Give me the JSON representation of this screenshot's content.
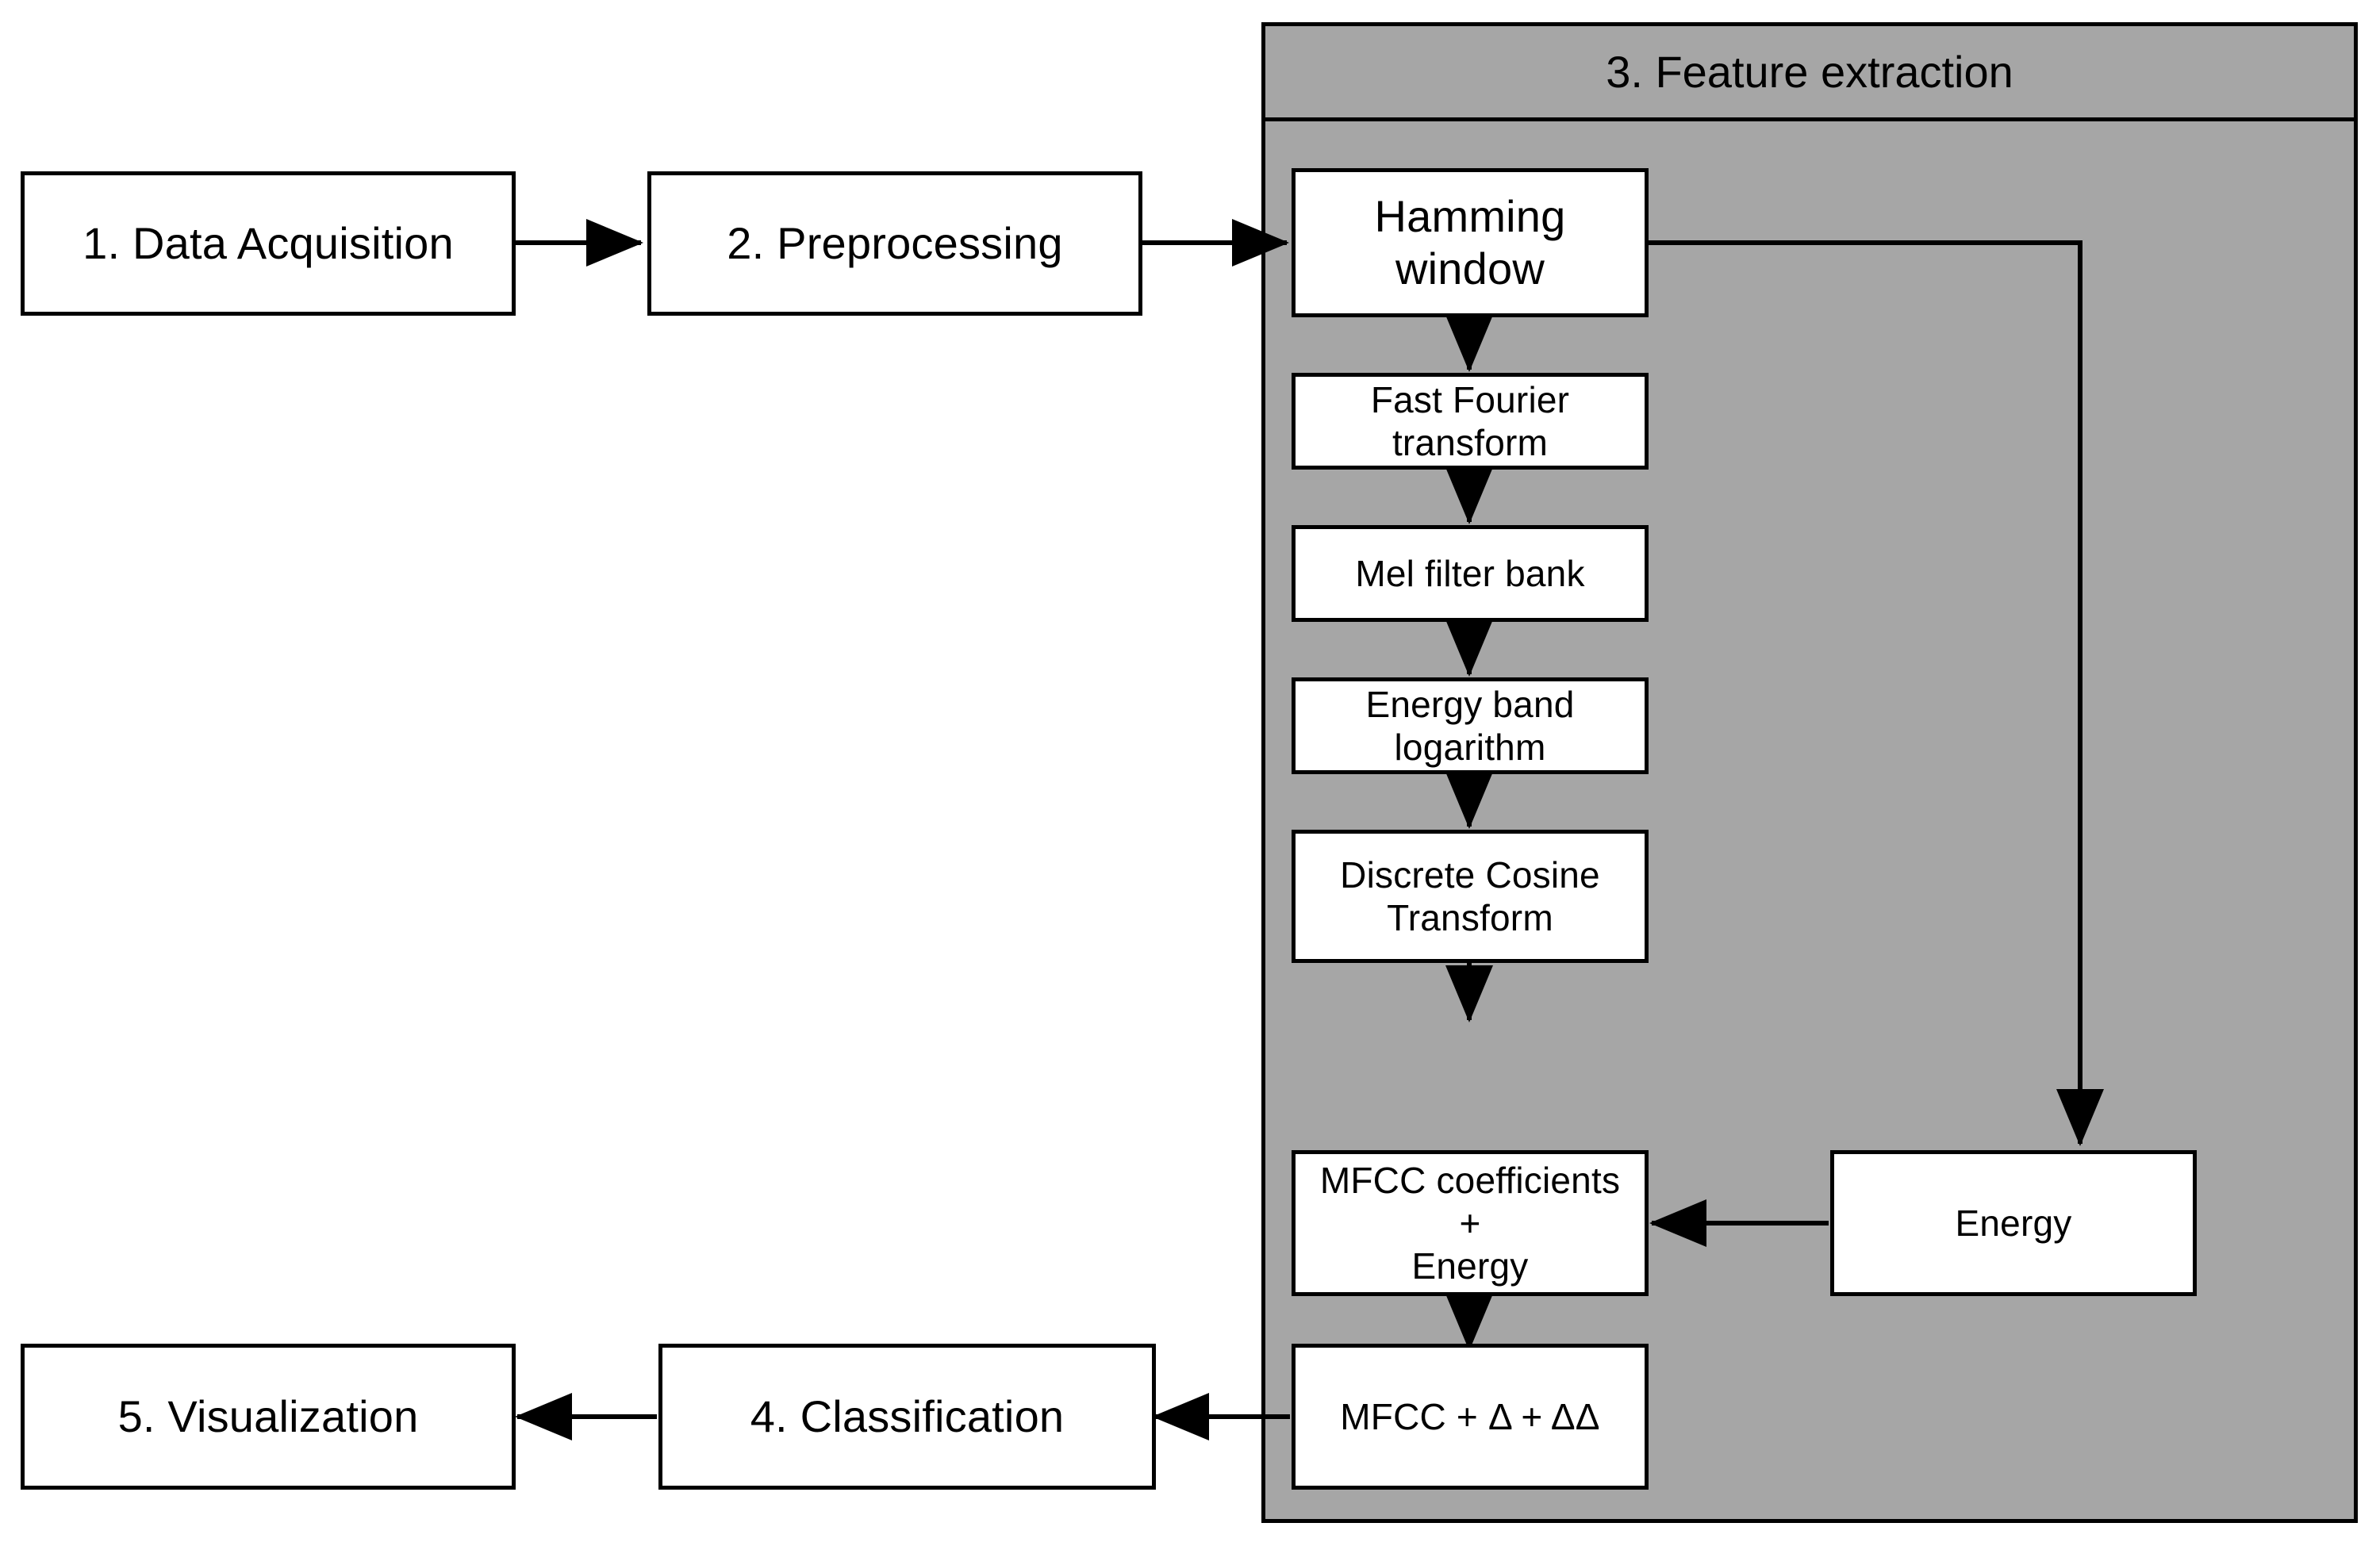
{
  "diagram": {
    "title": "Speech processing pipeline flowchart",
    "background_color": "#ffffff",
    "panel_fill_color": "#a6a6a6",
    "box_fill_color": "#ffffff",
    "line_color": "#000000"
  },
  "stages": {
    "data_acquisition": "1. Data Acquisition",
    "preprocessing": "2. Preprocessing",
    "feature_extraction": "3. Feature extraction",
    "classification": "4. Classification",
    "visualization": "5. Visualization"
  },
  "feature_extraction_steps": {
    "hamming_window": "Hamming window",
    "fast_fourier_transform": "Fast Fourier transform",
    "mel_filter_bank": "Mel filter bank",
    "energy_band_logarithm": "Energy band logarithm",
    "discrete_cosine_transform": "Discrete Cosine\nTransform",
    "mfcc_coefficients_energy": "MFCC coefficients +\nEnergy",
    "energy": "Energy",
    "mfcc_deltas": "MFCC + Δ + ΔΔ"
  },
  "flow": {
    "edges": [
      {
        "from": "1. Data Acquisition",
        "to": "2. Preprocessing"
      },
      {
        "from": "2. Preprocessing",
        "to": "Hamming window"
      },
      {
        "from": "Hamming window",
        "to": "Fast Fourier transform"
      },
      {
        "from": "Hamming window",
        "to": "Energy"
      },
      {
        "from": "Fast Fourier transform",
        "to": "Mel filter bank"
      },
      {
        "from": "Mel filter bank",
        "to": "Energy band logarithm"
      },
      {
        "from": "Energy band logarithm",
        "to": "Discrete Cosine Transform"
      },
      {
        "from": "Discrete Cosine Transform",
        "to": "MFCC coefficients + Energy"
      },
      {
        "from": "Energy",
        "to": "MFCC coefficients + Energy"
      },
      {
        "from": "MFCC coefficients + Energy",
        "to": "MFCC + Δ + ΔΔ"
      },
      {
        "from": "MFCC + Δ + ΔΔ",
        "to": "4. Classification"
      },
      {
        "from": "4. Classification",
        "to": "5. Visualization"
      }
    ]
  }
}
